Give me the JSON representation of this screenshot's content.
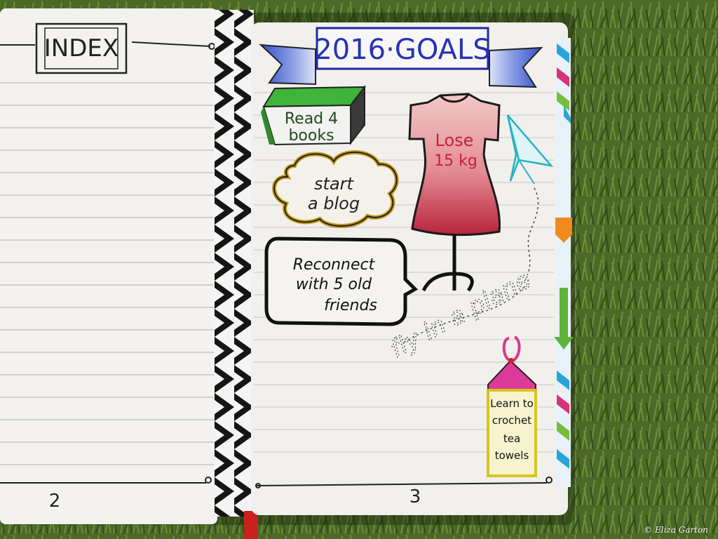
{
  "left_page": {
    "header": "INDEX",
    "page_number": "2"
  },
  "right_page": {
    "banner": {
      "year": "2016",
      "separator": "·",
      "word": "GOALS"
    },
    "page_number": "3",
    "goals": {
      "books": {
        "line1": "Read 4",
        "line2": "books"
      },
      "blog": {
        "line1": "start",
        "line2": "a blog"
      },
      "friends": {
        "line1": "Reconnect",
        "line2": "with 5 old",
        "line3": "friends"
      },
      "weight": {
        "line1": "Lose",
        "line2": "15 kg"
      },
      "plane": {
        "text": "fly in a plane"
      },
      "crochet": {
        "line1": "Learn to",
        "line2": "crochet",
        "line3": "tea",
        "line4": "towels"
      }
    }
  },
  "credit": "© Eliza Garton",
  "colors": {
    "grass": "#4f6e2a",
    "paper": "#f3f2ee",
    "rule": "#b9b9b9",
    "banner_blue": "#2c3fb5",
    "book_green": "#3aa836",
    "dress_pink": "#e98a8e",
    "bookmark": "#c8201c"
  }
}
